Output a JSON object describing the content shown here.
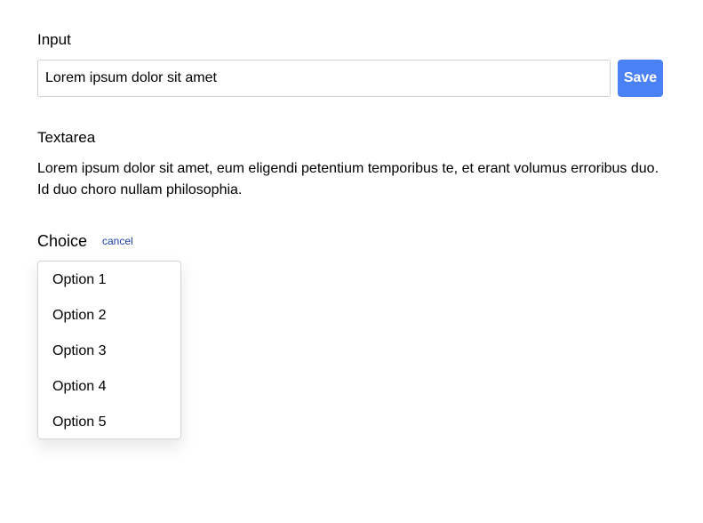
{
  "input_section": {
    "label": "Input",
    "value": "Lorem ipsum dolor sit amet",
    "save_label": "Save"
  },
  "textarea_section": {
    "label": "Textarea",
    "text": "Lorem ipsum dolor sit amet, eum eligendi petentium temporibus te, et erant volumus erroribus duo. Id duo choro nullam philosophia."
  },
  "choice_section": {
    "label": "Choice",
    "cancel_label": "cancel",
    "options": [
      "Option 1",
      "Option 2",
      "Option 3",
      "Option 4",
      "Option 5"
    ]
  },
  "colors": {
    "accent": "#4a82f5",
    "link": "#1a3fa8",
    "border": "#cfcfcf"
  }
}
